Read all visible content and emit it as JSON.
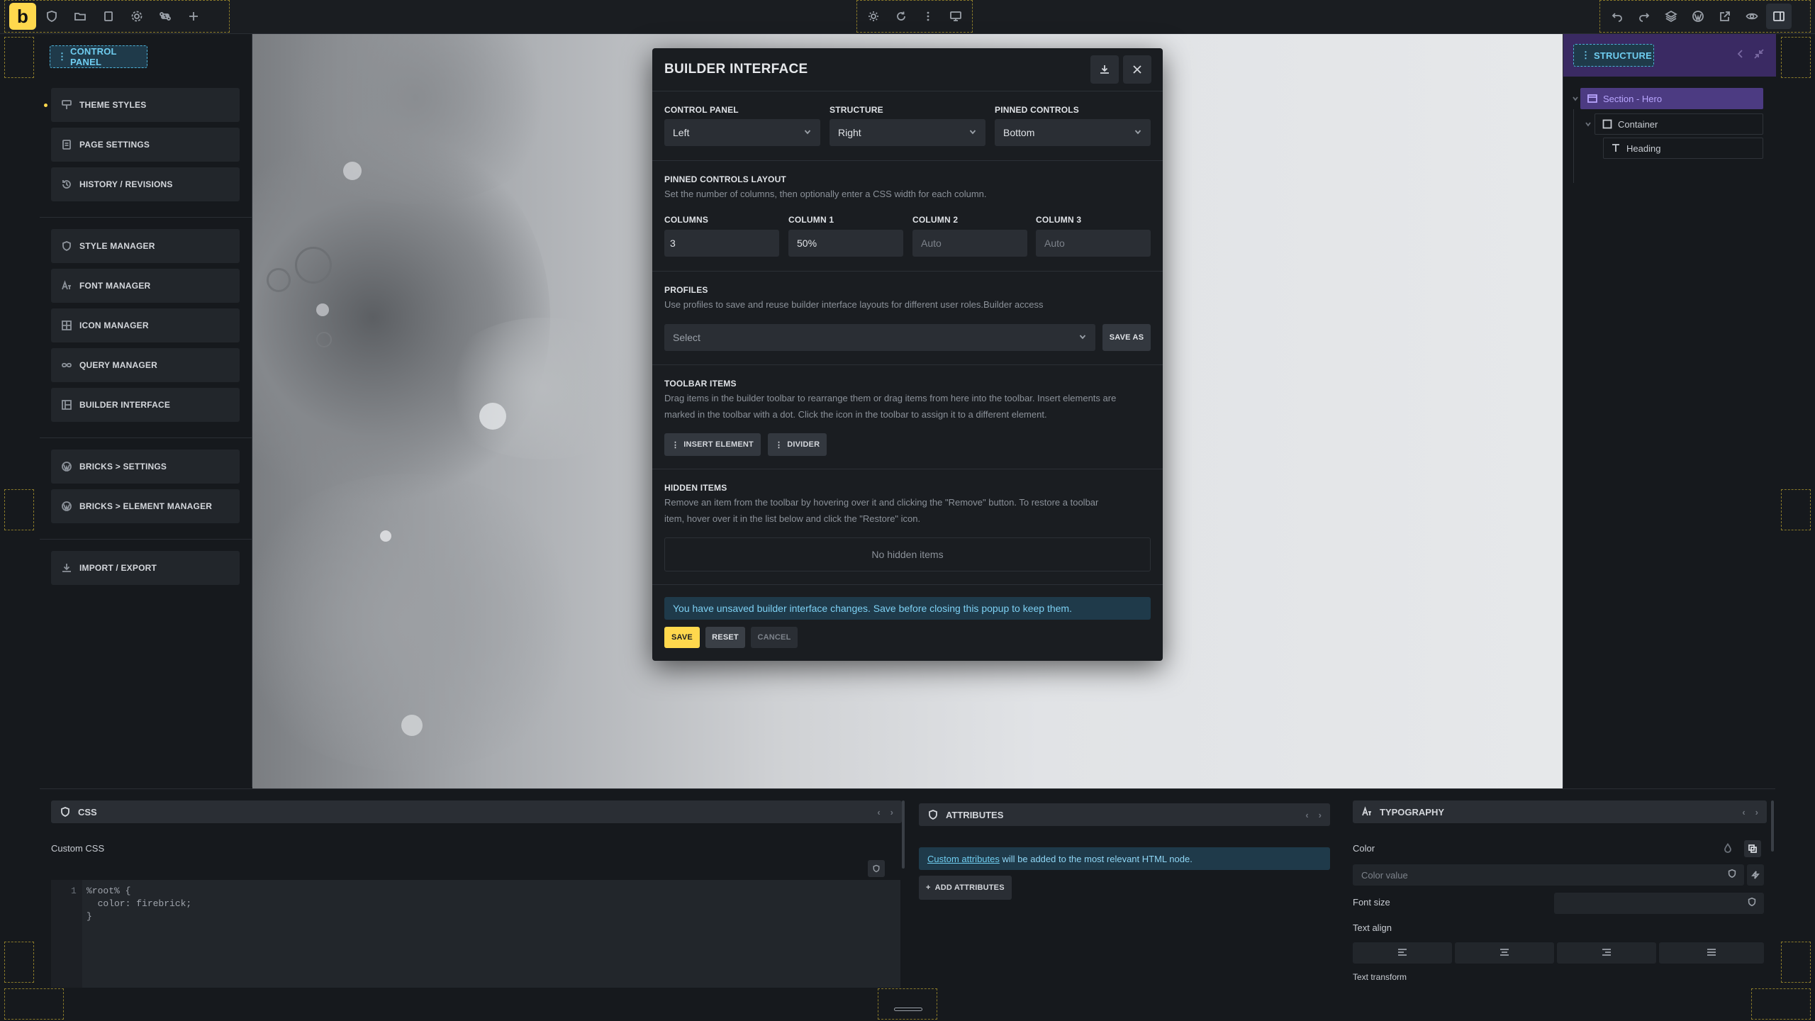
{
  "topbar": {
    "logo": "b",
    "left_icons": [
      "shield-icon",
      "folder-icon",
      "pages-icon",
      "gear-icon",
      "command-icon",
      "plus-icon"
    ],
    "center_icons": [
      "sun-icon",
      "refresh-icon",
      "more-vertical-icon",
      "desktop-icon"
    ],
    "right_icons": [
      "undo-icon",
      "redo-icon",
      "layers-icon",
      "wordpress-icon",
      "external-link-icon",
      "eye-icon",
      "panel-icon"
    ]
  },
  "left_panel": {
    "tag": "CONTROL PANEL",
    "group1": [
      "THEME STYLES",
      "PAGE SETTINGS",
      "HISTORY / REVISIONS"
    ],
    "group2": [
      "STYLE MANAGER",
      "FONT MANAGER",
      "ICON MANAGER",
      "QUERY MANAGER",
      "BUILDER INTERFACE"
    ],
    "group3": [
      "BRICKS > SETTINGS",
      "BRICKS > ELEMENT MANAGER"
    ],
    "group4": [
      "IMPORT / EXPORT"
    ]
  },
  "right_panel": {
    "tag": "STRUCTURE",
    "tree": [
      "Section - Hero",
      "Container",
      "Heading"
    ]
  },
  "modal": {
    "title": "BUILDER INTERFACE",
    "control_panel_label": "CONTROL PANEL",
    "control_panel_value": "Left",
    "structure_label": "STRUCTURE",
    "structure_value": "Right",
    "pinned_label": "PINNED CONTROLS",
    "pinned_value": "Bottom",
    "layout_heading": "PINNED CONTROLS LAYOUT",
    "layout_desc": "Set the number of columns, then optionally enter a CSS width for each column.",
    "columns_label": "COLUMNS",
    "columns_value": "3",
    "col1_label": "COLUMN 1",
    "col1_value": "50%",
    "col2_label": "COLUMN 2",
    "col2_placeholder": "Auto",
    "col3_label": "COLUMN 3",
    "col3_placeholder": "Auto",
    "profiles_heading": "PROFILES",
    "profiles_desc": "Use profiles to save and reuse builder interface layouts for different user roles.Builder access",
    "profiles_select": "Select",
    "save_as": "SAVE AS",
    "toolbar_heading": "TOOLBAR ITEMS",
    "toolbar_desc_1": "Drag items in the builder toolbar to rearrange them or drag items from here into the toolbar. Insert elements are",
    "toolbar_desc_2": "marked in the toolbar with a dot. Click the icon in the toolbar to assign it to a different element.",
    "chip_insert": "INSERT ELEMENT",
    "chip_divider": "DIVIDER",
    "hidden_heading": "HIDDEN ITEMS",
    "hidden_desc_1": "Remove an item from the toolbar by hovering over it and clicking the \"Remove\" button. To restore a toolbar",
    "hidden_desc_2": "item, hover over it in the list below and click the \"Restore\" icon.",
    "no_hidden": "No hidden items",
    "notice": "You have unsaved builder interface changes. Save before closing this popup to keep them.",
    "save": "SAVE",
    "reset": "RESET",
    "cancel": "CANCEL"
  },
  "css_panel": {
    "title": "CSS",
    "label": "Custom CSS",
    "line_number": "1",
    "code_line1": "%root% {",
    "code_line2": "  color: firebrick;",
    "code_line3": "}"
  },
  "attributes_panel": {
    "title": "ATTRIBUTES",
    "notice_link": "Custom attributes",
    "notice_rest": " will be added to the most relevant HTML node.",
    "add_button": "ADD ATTRIBUTES"
  },
  "typography_panel": {
    "title": "TYPOGRAPHY",
    "color_label": "Color",
    "color_placeholder": "Color value",
    "font_size_label": "Font size",
    "text_align_label": "Text align",
    "text_transform_label": "Text transform"
  },
  "colors": {
    "accent_yellow": "#ffd84d",
    "accent_blue": "#4db2d8",
    "structure_purple": "#3a2a63"
  }
}
